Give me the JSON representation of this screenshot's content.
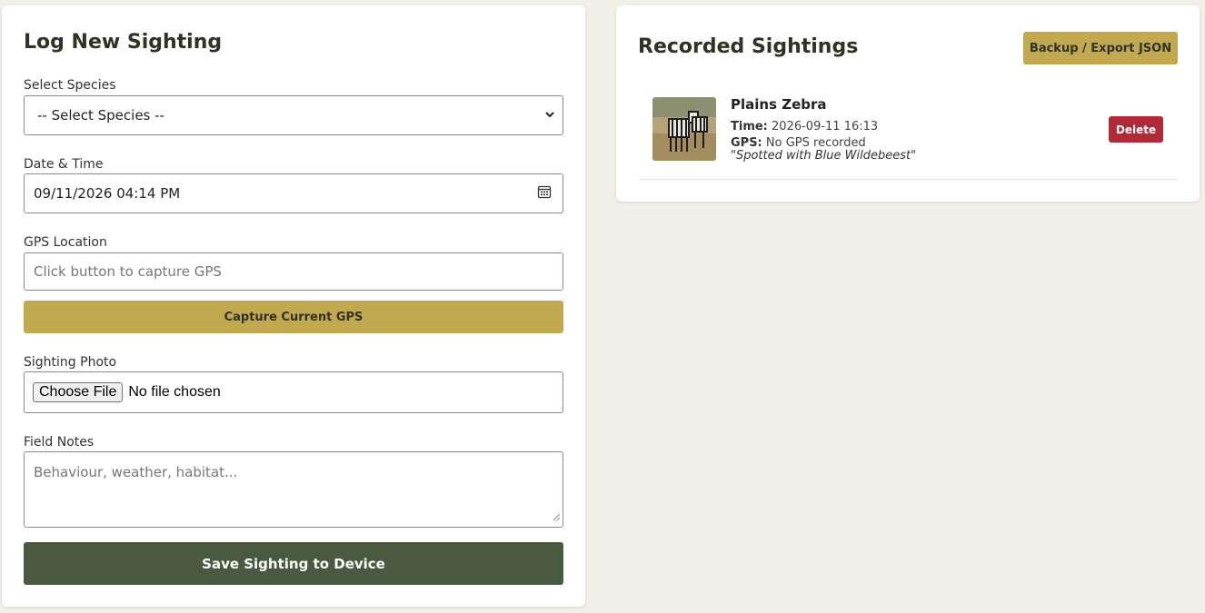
{
  "form": {
    "title": "Log New Sighting",
    "species_label": "Select Species",
    "species_selected": "-- Select Species --",
    "datetime_label": "Date & Time",
    "datetime_value": "09/11/2026 04:14 PM",
    "gps_label": "GPS Location",
    "gps_placeholder": "Click button to capture GPS",
    "gps_button": "Capture Current GPS",
    "photo_label": "Sighting Photo",
    "photo_button": "Choose File",
    "photo_status": "No file chosen",
    "notes_label": "Field Notes",
    "notes_placeholder": "Behaviour, weather, habitat...",
    "save_button": "Save Sighting to Device"
  },
  "sightings": {
    "title": "Recorded Sightings",
    "export_button": "Backup / Export JSON",
    "items": [
      {
        "name": "Plains Zebra",
        "time_label": "Time:",
        "time_value": "2026-09-11 16:13",
        "gps_label": "GPS:",
        "gps_value": "No GPS recorded",
        "notes": "\"Spotted with Blue Wildebeest\"",
        "delete_button": "Delete"
      }
    ]
  },
  "colors": {
    "accent_gold": "#c2a84f",
    "primary_green": "#4a5a41",
    "danger_red": "#b02a37",
    "background": "#f2efe8"
  }
}
